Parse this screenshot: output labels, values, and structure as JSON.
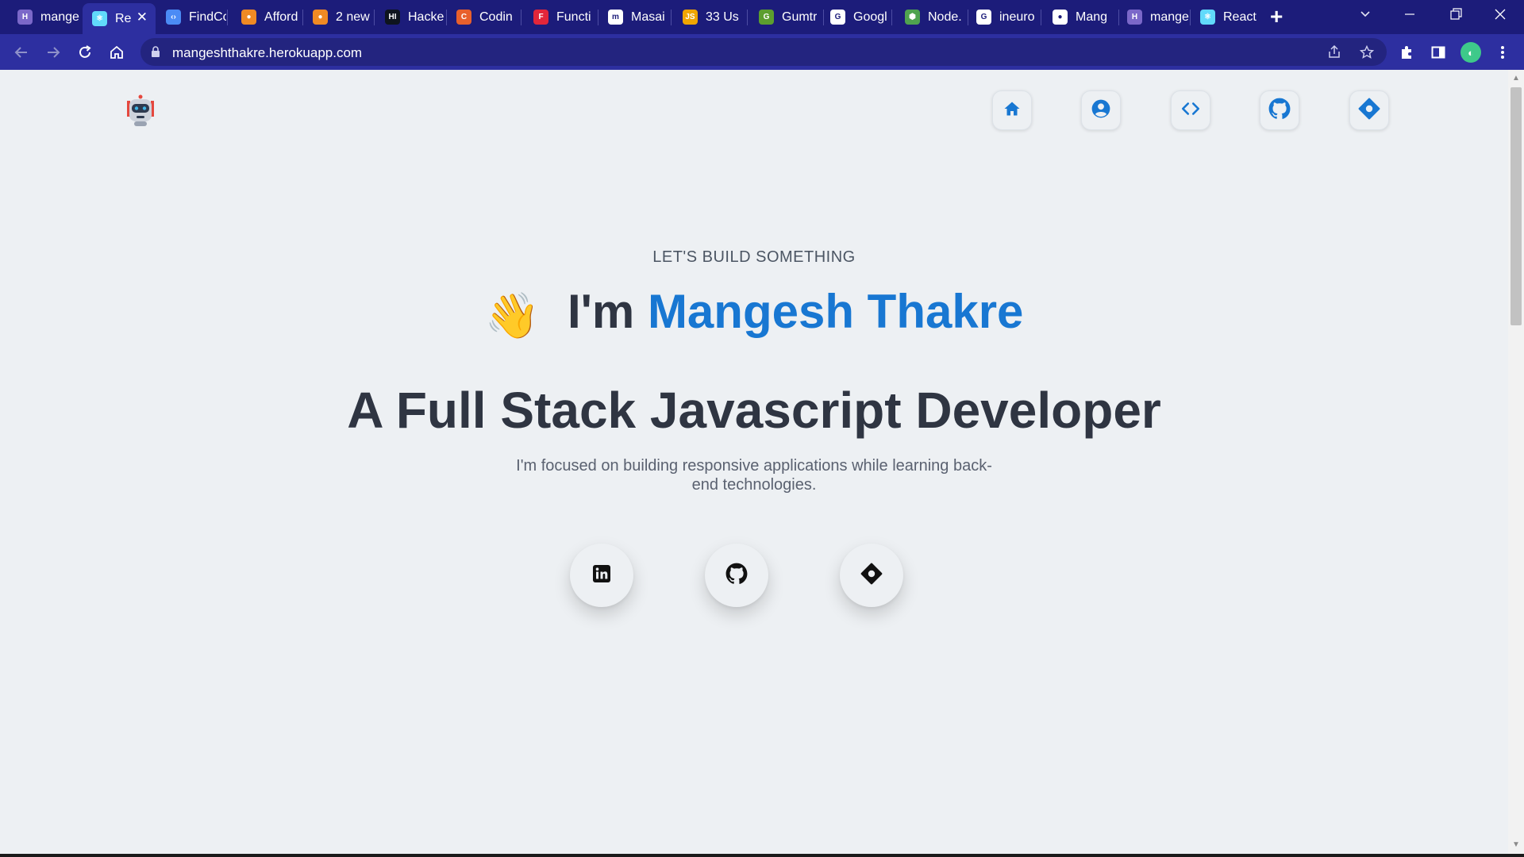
{
  "browser": {
    "tabs": [
      {
        "title": "mange",
        "favicon": "heroku-icon",
        "color": "#7b68c9",
        "glyph": "H"
      },
      {
        "title": "Re",
        "favicon": "react-icon",
        "color": "#61dafb",
        "glyph": "⚛",
        "active": true
      },
      {
        "title": "FindCc",
        "favicon": "code-brackets-icon",
        "color": "#4b8bf5",
        "glyph": "‹›"
      },
      {
        "title": "Afford",
        "favicon": "orange-circle-icon",
        "color": "#f08a24",
        "glyph": "●"
      },
      {
        "title": "2 new",
        "favicon": "orange-circle-icon",
        "color": "#f08a24",
        "glyph": "●"
      },
      {
        "title": "Hacke",
        "favicon": "hackerrank-icon",
        "color": "#0e141e",
        "glyph": "HI"
      },
      {
        "title": "Codin",
        "favicon": "coding-ninjas-icon",
        "color": "#e8602c",
        "glyph": "C"
      },
      {
        "title": "Functi",
        "favicon": "shield-icon",
        "color": "#e2263a",
        "glyph": "F"
      },
      {
        "title": "Masai",
        "favicon": "masai-icon",
        "color": "#ffffff",
        "glyph": "m"
      },
      {
        "title": "33 Us",
        "favicon": "js-icon",
        "color": "#f0a500",
        "glyph": "JS"
      },
      {
        "title": "Gumtr",
        "favicon": "gumroad-icon",
        "color": "#5c9e2e",
        "glyph": "G"
      },
      {
        "title": "Googl",
        "favicon": "google-icon",
        "color": "#ffffff",
        "glyph": "G"
      },
      {
        "title": "Node.",
        "favicon": "nodejs-icon",
        "color": "#4fa34f",
        "glyph": "⬢"
      },
      {
        "title": "ineuro",
        "favicon": "google-icon",
        "color": "#ffffff",
        "glyph": "G"
      },
      {
        "title": "Mang",
        "favicon": "github-icon",
        "color": "#ffffff",
        "glyph": "●"
      },
      {
        "title": "mange",
        "favicon": "heroku-icon",
        "color": "#7b68c9",
        "glyph": "H"
      },
      {
        "title": "React",
        "favicon": "react-icon",
        "color": "#61dafb",
        "glyph": "⚛"
      }
    ],
    "url": "mangeshthakre.herokuapp.com",
    "theme_color": "#1c1c7a",
    "toolbar_color": "#2d2fa0"
  },
  "page": {
    "accent_color": "#1877d2",
    "nav": [
      {
        "name": "home-icon"
      },
      {
        "name": "user-icon"
      },
      {
        "name": "code-icon"
      },
      {
        "name": "github-icon"
      },
      {
        "name": "diamond-icon"
      }
    ],
    "hero": {
      "eyebrow": "LET'S BUILD SOMETHING",
      "greeting_prefix": "I'm",
      "name": "Mangesh Thakre",
      "wave_emoji": "👋",
      "headline": "A Full Stack Javascript Developer",
      "description": "I'm focused on building responsive applications while learning back-end technologies."
    },
    "social": [
      {
        "name": "linkedin-icon"
      },
      {
        "name": "github-icon"
      },
      {
        "name": "diamond-icon"
      }
    ]
  }
}
